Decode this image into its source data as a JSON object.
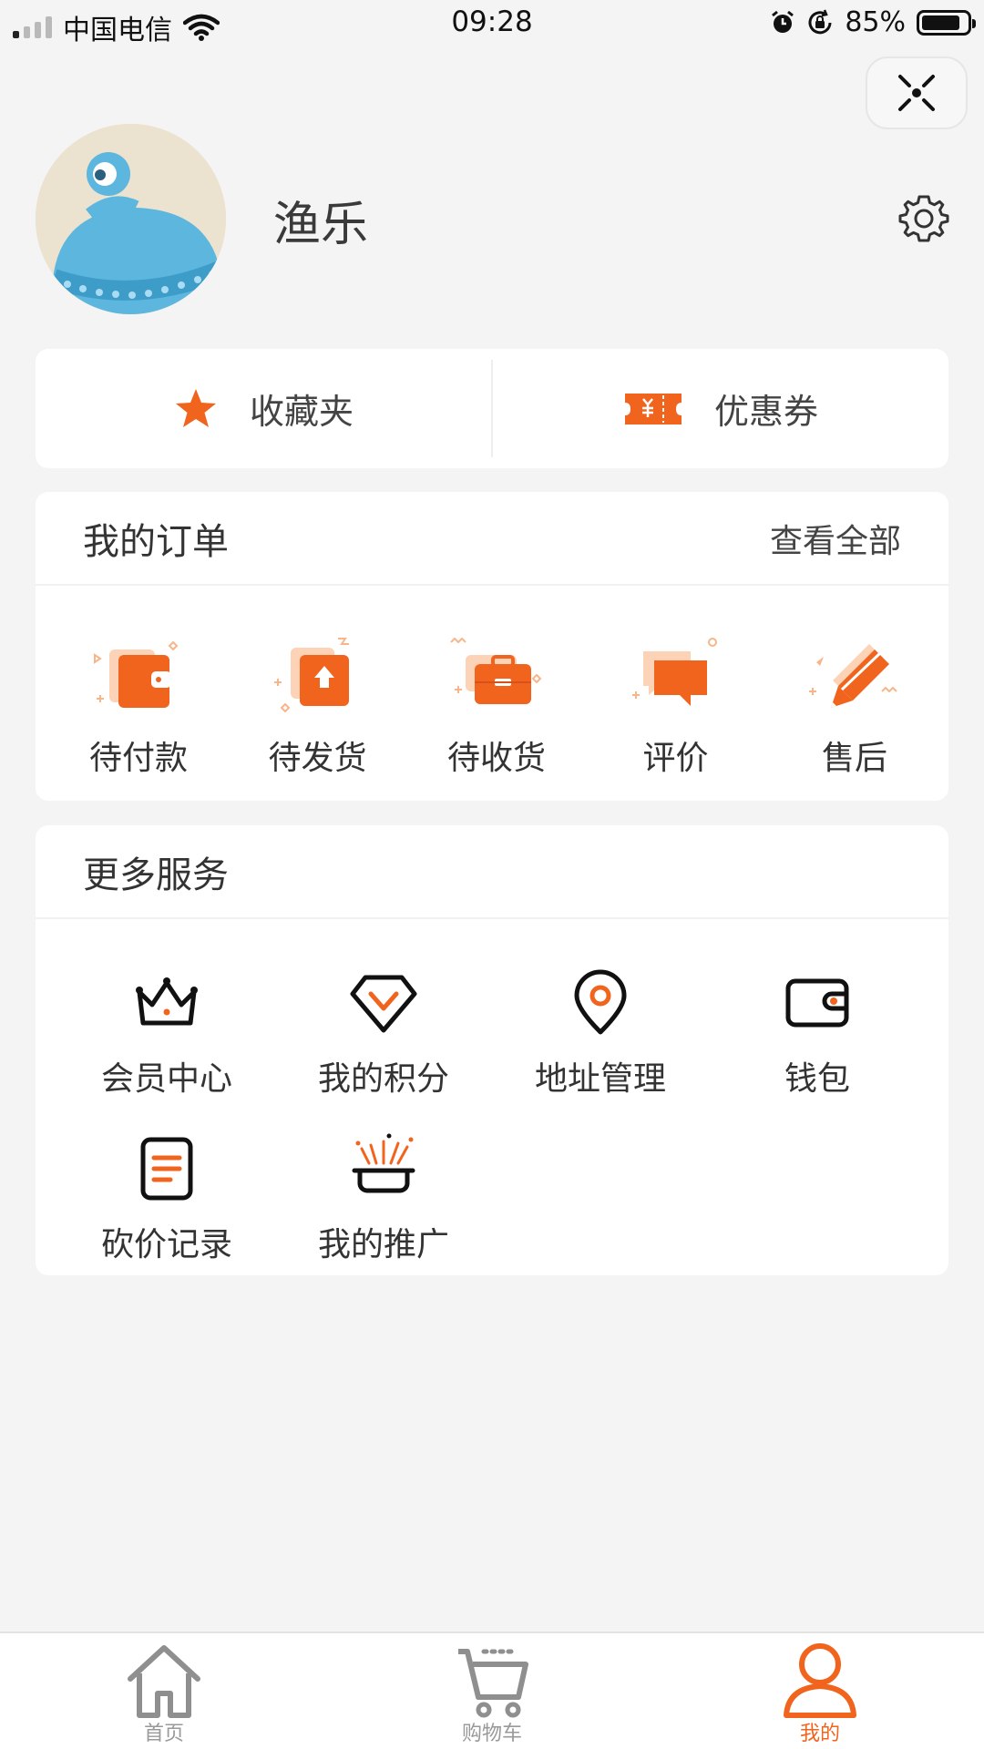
{
  "status_bar": {
    "carrier": "中国电信",
    "time": "09:28",
    "battery": "85%",
    "battery_level": 0.85
  },
  "profile": {
    "username": "渔乐"
  },
  "quick_actions": [
    {
      "label": "收藏夹",
      "icon": "star-icon"
    },
    {
      "label": "优惠券",
      "icon": "coupon-ticket-icon"
    }
  ],
  "orders": {
    "title": "我的订单",
    "view_all": "查看全部",
    "items": [
      {
        "label": "待付款",
        "icon": "wallet-icon"
      },
      {
        "label": "待发货",
        "icon": "box-upload-icon"
      },
      {
        "label": "待收货",
        "icon": "briefcase-icon"
      },
      {
        "label": "评价",
        "icon": "chat-bubble-icon"
      },
      {
        "label": "售后",
        "icon": "pencil-icon"
      }
    ]
  },
  "services": {
    "title": "更多服务",
    "items": [
      {
        "label": "会员中心",
        "icon": "crown-icon"
      },
      {
        "label": "我的积分",
        "icon": "diamond-icon"
      },
      {
        "label": "地址管理",
        "icon": "location-pin-icon"
      },
      {
        "label": "钱包",
        "icon": "wallet-outline-icon"
      },
      {
        "label": "砍价记录",
        "icon": "document-icon"
      },
      {
        "label": "我的推广",
        "icon": "magic-hat-icon"
      }
    ]
  },
  "tabbar": {
    "tabs": [
      {
        "label": "首页",
        "icon": "home-icon",
        "active": false
      },
      {
        "label": "购物车",
        "icon": "cart-icon",
        "active": false
      },
      {
        "label": "我的",
        "icon": "user-icon",
        "active": true
      }
    ]
  },
  "colors": {
    "accent": "#f0641e",
    "background": "#f4f4f4"
  }
}
